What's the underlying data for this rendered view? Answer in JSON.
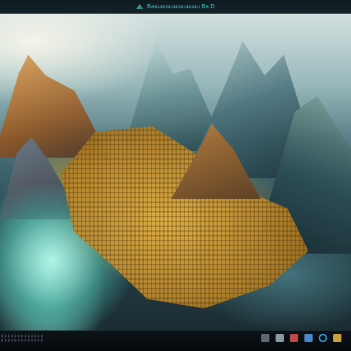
{
  "window": {
    "title": "Bauuuuuuuuuuuuuu  Ba  D",
    "app_icon": "mountain-app-icon"
  },
  "canvas": {
    "image_subject": "fantasy-landscape-city-mountains"
  },
  "taskbar": {
    "status_lines": [
      "B B 6 8 8 8 8 8 8 8 8 8 8",
      "8 8 8 8 8 8 8 8 8 8 8 8 8"
    ],
    "tray_icons": [
      {
        "name": "square-app-icon",
        "color": "#5b6a72"
      },
      {
        "name": "image-app-icon",
        "color": "#8a9aa2"
      },
      {
        "name": "red-app-icon",
        "color": "#c04848"
      },
      {
        "name": "monitor-app-icon",
        "color": "#4a86c8"
      },
      {
        "name": "ring-app-icon",
        "color": "#3aa0e8"
      },
      {
        "name": "gold-app-icon",
        "color": "#c9a040"
      }
    ]
  }
}
